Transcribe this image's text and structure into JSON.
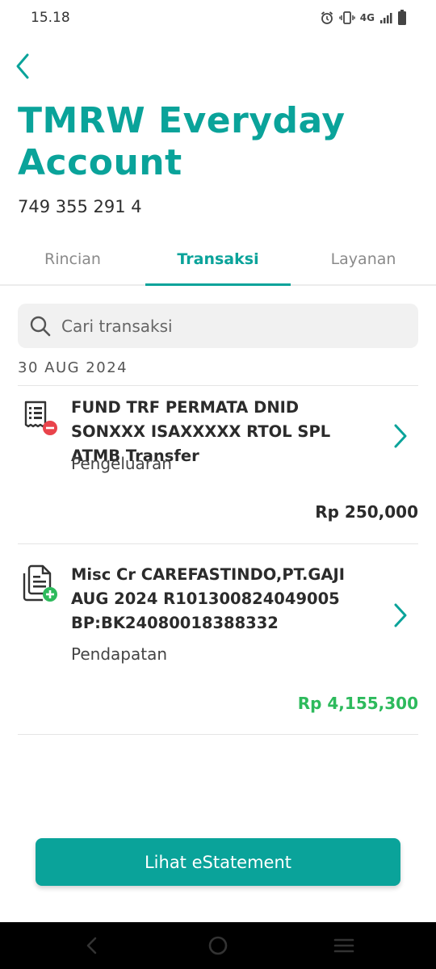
{
  "status_bar": {
    "time": "15.18",
    "network": "4G",
    "icons": [
      "alarm-icon",
      "vibrate-icon",
      "signal-icon",
      "battery-icon"
    ]
  },
  "header": {
    "back_icon": "chevron-left-icon",
    "title": "TMRW Everyday Account",
    "account_number": "749 355 291 4"
  },
  "tabs": [
    {
      "label": "Rincian",
      "active": false
    },
    {
      "label": "Transaksi",
      "active": true
    },
    {
      "label": "Layanan",
      "active": false
    }
  ],
  "search": {
    "icon": "search-icon",
    "placeholder": "Cari transaksi"
  },
  "transactions_group": {
    "date": "30 AUG 2024",
    "items": [
      {
        "description": "FUND TRF PERMATA DNID SONXXX ISAXXXXX RTOL SPL ATMB Transfer",
        "type": "Pengeluaran",
        "amount": "Rp 250,000",
        "direction": "out",
        "amount_color": "#2b2b2b",
        "icon": "expense-receipt-icon"
      },
      {
        "description": "Misc Cr CAREFASTINDO,PT.GAJI AUG 2024 R101300824049005 BP:BK24080018388332",
        "type": "Pendapatan",
        "amount": "Rp 4,155,300",
        "direction": "in",
        "amount_color": "#2dba5c",
        "icon": "income-document-icon"
      }
    ]
  },
  "footer": {
    "estatement_label": "Lihat eStatement"
  },
  "colors": {
    "accent": "#0aa39a",
    "income": "#2dba5c",
    "expense_badge": "#e9434b"
  }
}
